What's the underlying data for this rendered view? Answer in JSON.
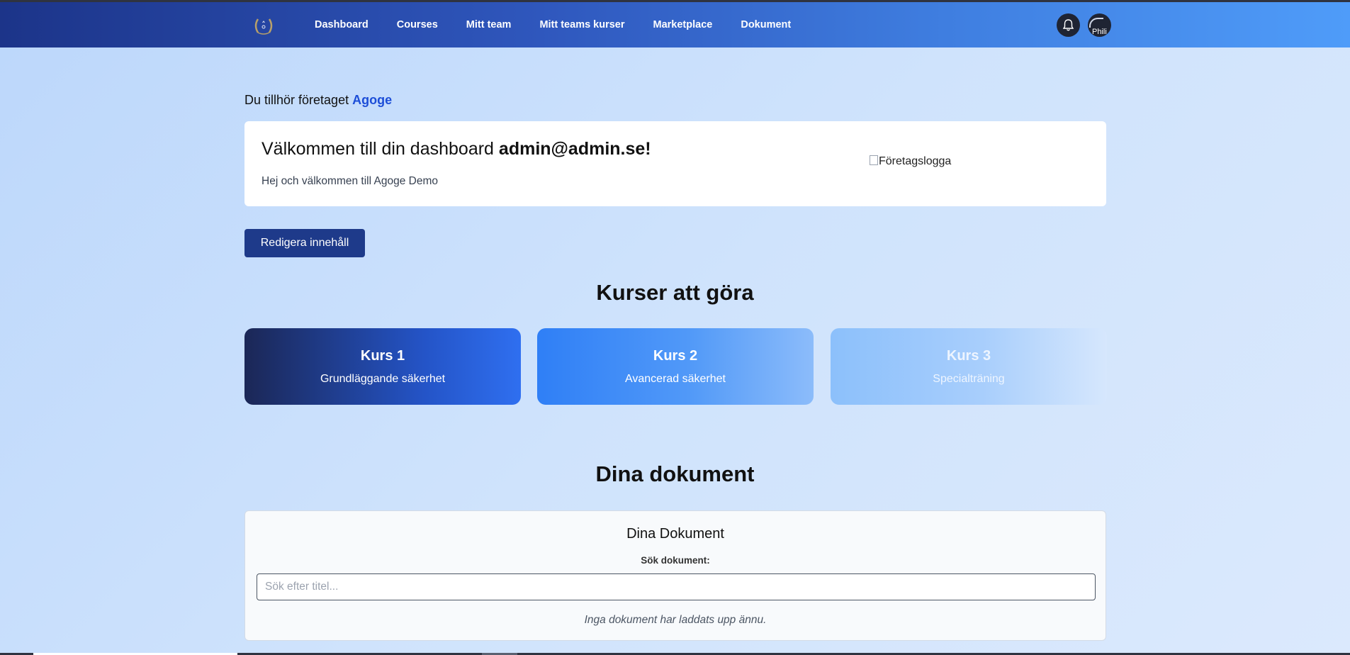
{
  "colors": {
    "accent": "#1d4ed8",
    "button_bg": "#1e3a8a",
    "navbar_start": "#1c3489",
    "navbar_end": "#4f9cf9"
  },
  "nav": {
    "logo_icon": "laurel-logo-icon",
    "links": [
      "Dashboard",
      "Courses",
      "Mitt team",
      "Mitt teams kurser",
      "Marketplace",
      "Dokument"
    ],
    "bell_icon": "bell-icon",
    "avatar_text": "Phili"
  },
  "company": {
    "prefix": "Du tillhör företaget",
    "name": "Agoge"
  },
  "welcome": {
    "title_prefix": "Välkommen till din dashboard",
    "email": "admin@admin.se!",
    "subtitle": "Hej och välkommen till Agoge Demo",
    "logo_alt": "Företagslogga"
  },
  "edit_button": "Redigera innehåll",
  "courses_section": {
    "title": "Kurser att göra",
    "courses": [
      {
        "name": "Kurs 1",
        "desc": "Grundläggande säkerhet"
      },
      {
        "name": "Kurs 2",
        "desc": "Avancerad säkerhet"
      },
      {
        "name": "Kurs 3",
        "desc": "Specialträning"
      }
    ]
  },
  "documents_section": {
    "title": "Dina dokument",
    "card_title": "Dina Dokument",
    "search_label": "Sök dokument:",
    "search_placeholder": "Sök efter titel...",
    "search_value": "",
    "empty_note": "Inga dokument har laddats upp ännu."
  }
}
